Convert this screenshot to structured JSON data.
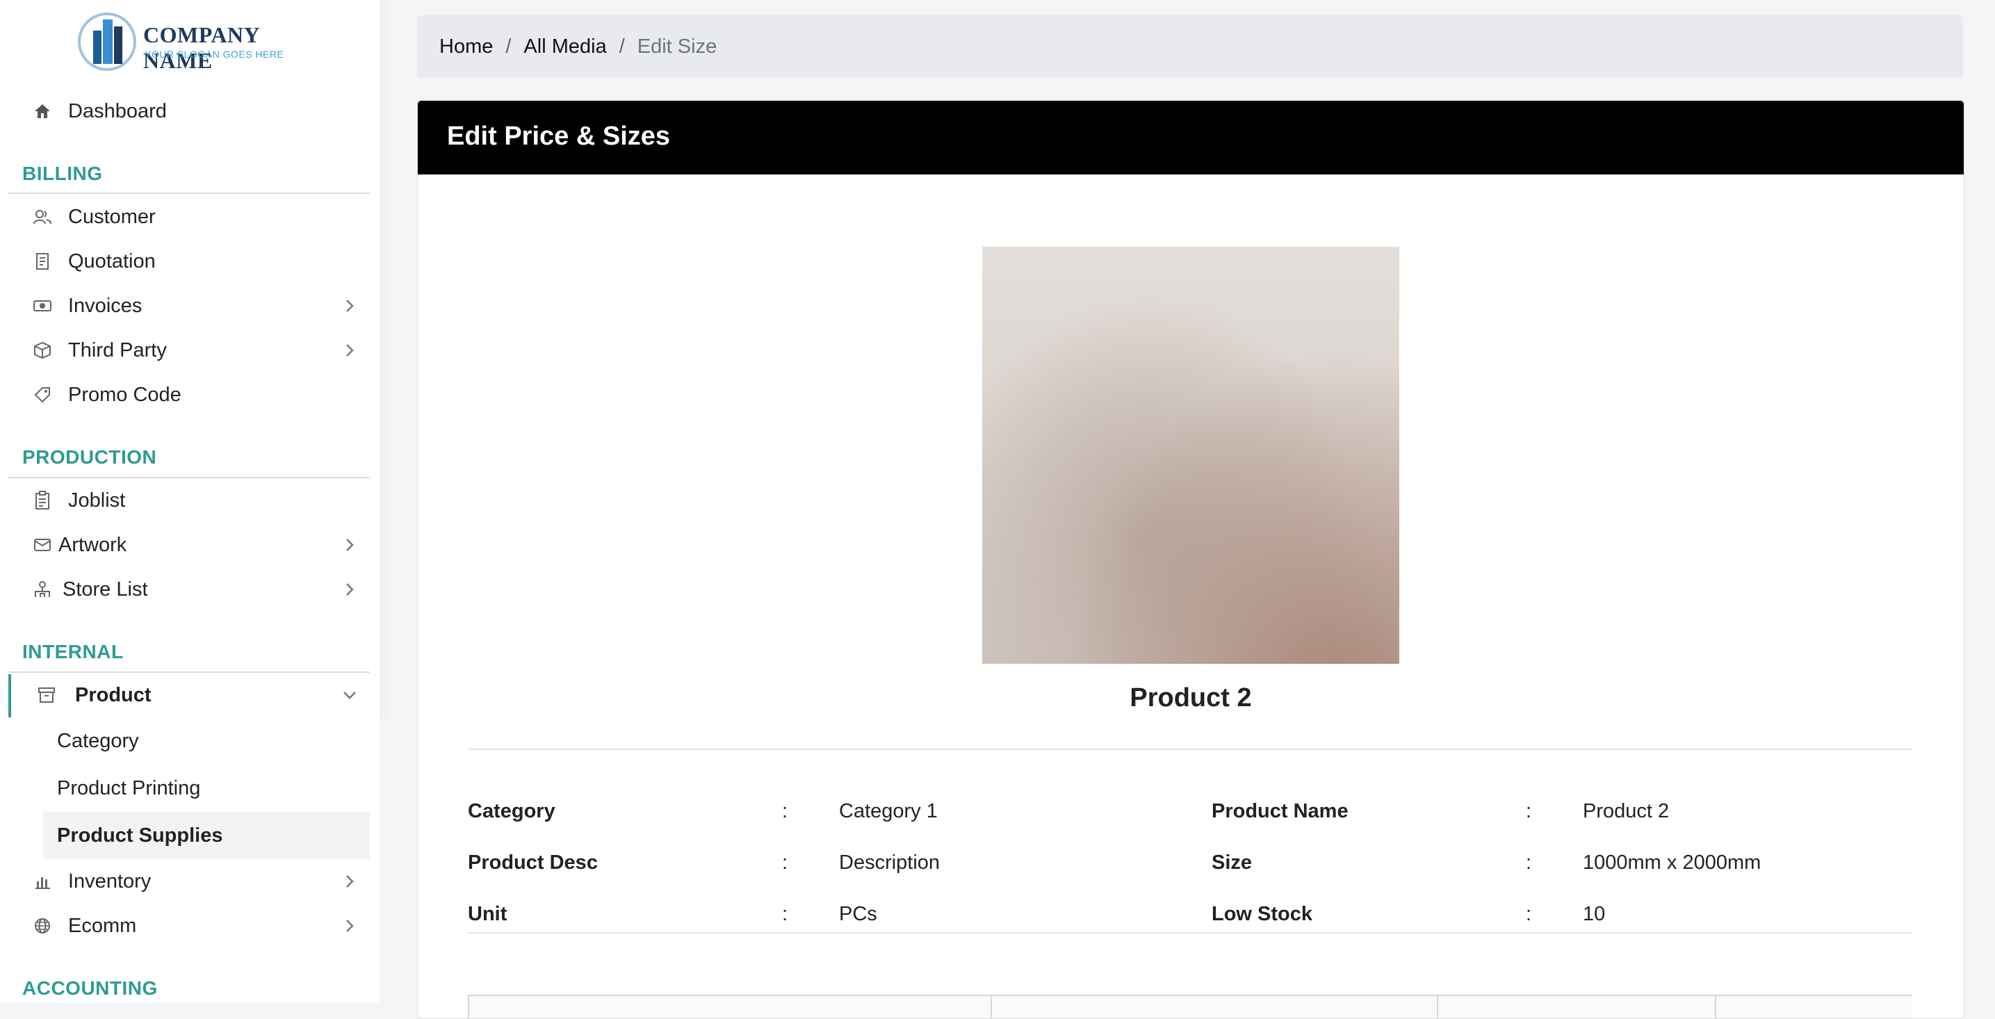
{
  "brand": {
    "name": "COMPANY NAME",
    "slogan": "YOUR SLOGAN GOES HERE",
    "primary_color": "#1f3a5c",
    "accent_color": "#2e9b94"
  },
  "sidebar": {
    "dashboard": {
      "label": "Dashboard",
      "icon": "home-icon"
    },
    "sections": [
      {
        "title": "BILLING",
        "items": [
          {
            "label": "Customer",
            "icon": "users-icon"
          },
          {
            "label": "Quotation",
            "icon": "document-icon"
          },
          {
            "label": "Invoices",
            "icon": "money-icon"
          },
          {
            "label": "Third Party",
            "icon": "box-icon"
          },
          {
            "label": "Promo Code",
            "icon": "tag-icon"
          }
        ]
      },
      {
        "title": "PRODUCTION",
        "items": [
          {
            "label": "Joblist",
            "icon": "clipboard-icon"
          },
          {
            "label": "Artwork",
            "icon": "envelope-icon"
          },
          {
            "label": "Store List",
            "icon": "store-icon"
          }
        ]
      },
      {
        "title": "INTERNAL",
        "items": [
          {
            "label": "Product",
            "icon": "archive-icon"
          },
          {
            "label": "Inventory",
            "icon": "bar-chart-icon"
          },
          {
            "label": "Ecomm",
            "icon": "globe-icon"
          }
        ]
      },
      {
        "title": "ACCOUNTING",
        "items": []
      }
    ],
    "product_subitems": [
      "Category",
      "Product Printing",
      "Product Supplies"
    ],
    "active_subitem": "Product Supplies"
  },
  "breadcrumb": {
    "items": [
      "Home",
      "All Media"
    ],
    "current": "Edit Size",
    "separator": "/"
  },
  "card": {
    "title": "Edit Price & Sizes"
  },
  "product": {
    "name": "Product 2",
    "details_left": [
      {
        "label": "Category",
        "value": "Category 1"
      },
      {
        "label": "Product Desc",
        "value": "Description"
      },
      {
        "label": "Unit",
        "value": "PCs"
      }
    ],
    "details_right": [
      {
        "label": "Product Name",
        "value": "Product 2"
      },
      {
        "label": "Size",
        "value": "1000mm x 2000mm"
      },
      {
        "label": "Low Stock",
        "value": "10"
      }
    ],
    "colon": ":"
  }
}
